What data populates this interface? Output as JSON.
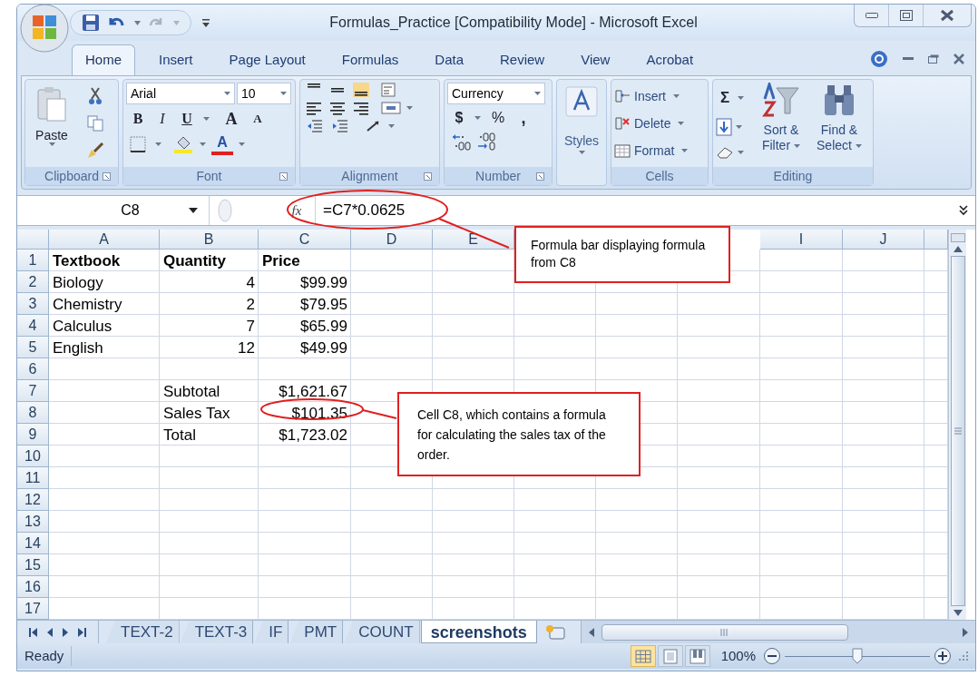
{
  "window": {
    "title": "Formulas_Practice  [Compatibility Mode] - Microsoft Excel"
  },
  "ribbon_tabs": [
    {
      "label": "Home",
      "selected": true
    },
    {
      "label": "Insert",
      "selected": false
    },
    {
      "label": "Page Layout",
      "selected": false
    },
    {
      "label": "Formulas",
      "selected": false
    },
    {
      "label": "Data",
      "selected": false
    },
    {
      "label": "Review",
      "selected": false
    },
    {
      "label": "View",
      "selected": false
    },
    {
      "label": "Acrobat",
      "selected": false
    }
  ],
  "ribbon": {
    "clipboard": {
      "paste": "Paste",
      "label": "Clipboard"
    },
    "font": {
      "name": "Arial",
      "size": "10",
      "bold": "B",
      "italic": "I",
      "underline": "U",
      "grow": "A",
      "shrink": "A",
      "font_color_button": "A",
      "label": "Font"
    },
    "alignment": {
      "label": "Alignment"
    },
    "number": {
      "format": "Currency",
      "currency": "$",
      "percent": "%",
      "comma": ",",
      "label": "Number"
    },
    "styles": {
      "button": "Styles"
    },
    "cells": {
      "insert": "Insert",
      "delete": "Delete",
      "format": "Format",
      "label": "Cells"
    },
    "editing": {
      "sum": "Σ",
      "sort": [
        "Sort &",
        "Filter"
      ],
      "find": [
        "Find &",
        "Select"
      ],
      "label": "Editing"
    }
  },
  "formula_bar": {
    "name_box": "C8",
    "fx": "fx",
    "formula": "=C7*0.0625"
  },
  "columns": [
    "A",
    "B",
    "C",
    "D",
    "E"
  ],
  "columns_right": [
    "I",
    "J"
  ],
  "rows": [
    {
      "number": "1",
      "A": {
        "text": "Textbook",
        "kind": "text",
        "bold": true
      },
      "B": {
        "text": "Quantity",
        "kind": "text",
        "bold": true
      },
      "C": {
        "text": "Price",
        "kind": "text",
        "bold": true
      }
    },
    {
      "number": "2",
      "A": {
        "text": "Biology",
        "kind": "text",
        "bold": false
      },
      "B": {
        "text": "4",
        "kind": "number",
        "bold": false
      },
      "C": {
        "text": "$99.99",
        "kind": "number",
        "bold": false
      }
    },
    {
      "number": "3",
      "A": {
        "text": "Chemistry",
        "kind": "text",
        "bold": false
      },
      "B": {
        "text": "2",
        "kind": "number",
        "bold": false
      },
      "C": {
        "text": "$79.95",
        "kind": "number",
        "bold": false
      }
    },
    {
      "number": "4",
      "A": {
        "text": "Calculus",
        "kind": "text",
        "bold": false
      },
      "B": {
        "text": "7",
        "kind": "number",
        "bold": false
      },
      "C": {
        "text": "$65.99",
        "kind": "number",
        "bold": false
      }
    },
    {
      "number": "5",
      "A": {
        "text": "English",
        "kind": "text",
        "bold": false
      },
      "B": {
        "text": "12",
        "kind": "number",
        "bold": false
      },
      "C": {
        "text": "$49.99",
        "kind": "number",
        "bold": false
      }
    },
    {
      "number": "6"
    },
    {
      "number": "7",
      "B": {
        "text": "Subtotal",
        "kind": "text",
        "bold": false
      },
      "C": {
        "text": "$1,621.67",
        "kind": "number",
        "bold": false
      }
    },
    {
      "number": "8",
      "B": {
        "text": "Sales Tax",
        "kind": "text",
        "bold": false
      },
      "C": {
        "text": "$101.35",
        "kind": "number",
        "bold": false
      }
    },
    {
      "number": "9",
      "B": {
        "text": "Total",
        "kind": "text",
        "bold": false
      },
      "C": {
        "text": "$1,723.02",
        "kind": "number",
        "bold": false
      }
    },
    {
      "number": "10"
    },
    {
      "number": "11"
    },
    {
      "number": "12"
    },
    {
      "number": "13"
    },
    {
      "number": "14"
    },
    {
      "number": "15"
    },
    {
      "number": "16"
    },
    {
      "number": "17"
    }
  ],
  "sheet_tabs": [
    {
      "label": "TEXT-2",
      "selected": false
    },
    {
      "label": "TEXT-3",
      "selected": false
    },
    {
      "label": "IF",
      "selected": false
    },
    {
      "label": "PMT",
      "selected": false
    },
    {
      "label": "COUNT",
      "selected": false
    },
    {
      "label": "screenshots",
      "selected": true
    }
  ],
  "status_bar": {
    "text": "Ready",
    "views": [
      {
        "selected": true
      },
      {
        "selected": false
      },
      {
        "selected": false
      }
    ],
    "zoom": "100%",
    "zoom_slider": {
      "level": 0.5
    }
  },
  "callouts": [
    {
      "text": "Formula bar displaying formula from C8"
    },
    {
      "text": "Cell C8, which contains a formula for calculating the sales tax of the order."
    }
  ]
}
